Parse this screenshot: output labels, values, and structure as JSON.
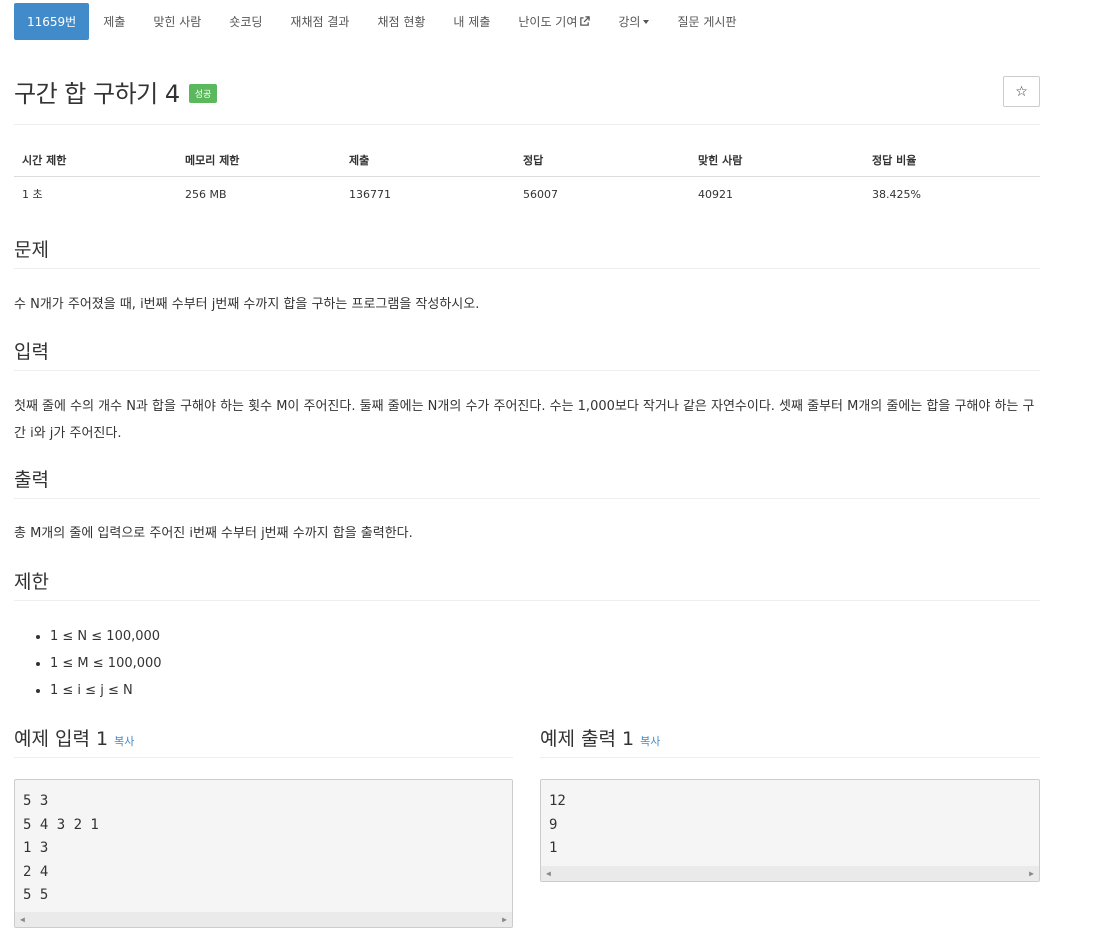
{
  "nav": {
    "tabs": [
      {
        "label": "11659번",
        "active": true
      },
      {
        "label": "제출"
      },
      {
        "label": "맞힌 사람"
      },
      {
        "label": "숏코딩"
      },
      {
        "label": "재채점 결과"
      },
      {
        "label": "채점 현황"
      },
      {
        "label": "내 제출"
      },
      {
        "label": "난이도 기여"
      },
      {
        "label": "강의"
      },
      {
        "label": "질문 게시판"
      }
    ]
  },
  "problem": {
    "title": "구간 합 구하기 4",
    "badge": "성공",
    "star_icon": "☆"
  },
  "info": {
    "headers": [
      "시간 제한",
      "메모리 제한",
      "제출",
      "정답",
      "맞힌 사람",
      "정답 비율"
    ],
    "values": [
      "1 초",
      "256 MB",
      "136771",
      "56007",
      "40921",
      "38.425%"
    ]
  },
  "sections": {
    "problem": {
      "heading": "문제",
      "text": "수 N개가 주어졌을 때, i번째 수부터 j번째 수까지 합을 구하는 프로그램을 작성하시오."
    },
    "input": {
      "heading": "입력",
      "text": "첫째 줄에 수의 개수 N과 합을 구해야 하는 횟수 M이 주어진다. 둘째 줄에는 N개의 수가 주어진다. 수는 1,000보다 작거나 같은 자연수이다. 셋째 줄부터 M개의 줄에는 합을 구해야 하는 구간 i와 j가 주어진다."
    },
    "output": {
      "heading": "출력",
      "text": "총 M개의 줄에 입력으로 주어진 i번째 수부터 j번째 수까지 합을 출력한다."
    },
    "limits": {
      "heading": "제한",
      "items": [
        "1 ≤ N ≤ 100,000",
        "1 ≤ M ≤ 100,000",
        "1 ≤ i ≤ j ≤ N"
      ]
    }
  },
  "samples": {
    "input": {
      "heading": "예제 입력 1",
      "copy": "복사",
      "code": "5 3\n5 4 3 2 1\n1 3\n2 4\n5 5"
    },
    "output": {
      "heading": "예제 출력 1",
      "copy": "복사",
      "code": "12\n9\n1"
    }
  }
}
